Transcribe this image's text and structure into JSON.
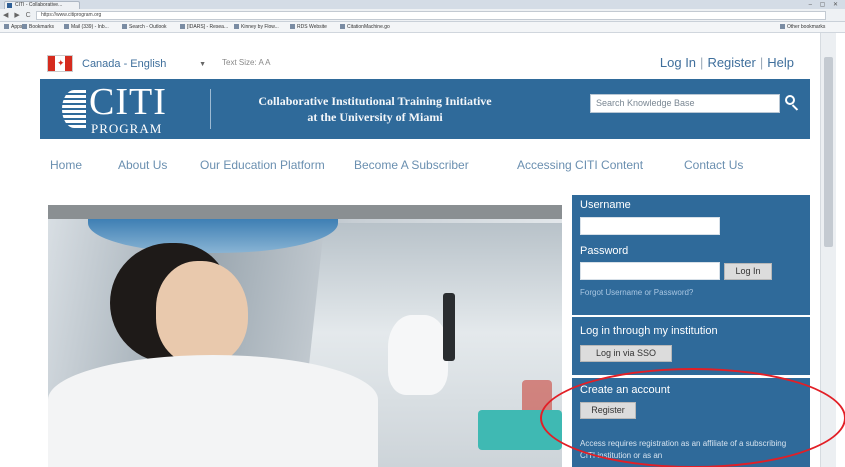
{
  "browser": {
    "tab_title": "CITI - Collaborative...",
    "window_controls": "–  ▢  ✕",
    "nav_buttons": "◀ ▶ C",
    "url": "https://www.citiprogram.org",
    "bookmarks": [
      "Apps",
      "Bookmarks",
      "Mail (339) - Inb...",
      "Search - Outlook",
      "[IDARS] - Resea...",
      "Kinney by Flow...",
      "RDS Website",
      "CitationMachine.go"
    ],
    "other_bookmarks": "Other bookmarks"
  },
  "topbar": {
    "language": "Canada - English",
    "text_size": "Text Size: A A",
    "login": "Log In",
    "separator": "|",
    "register": "Register",
    "help": "Help"
  },
  "banner": {
    "logo_main": "CITI",
    "logo_sub": "PROGRAM",
    "tagline_line1": "Collaborative Institutional Training Initiative",
    "tagline_line2": "at the University of Miami",
    "search_placeholder": "Search Knowledge Base"
  },
  "nav": {
    "items": [
      "Home",
      "About Us",
      "Our Education Platform",
      "Become A Subscriber",
      "Accessing CITI Content",
      "Contact Us"
    ]
  },
  "login_panel": {
    "username_label": "Username",
    "password_label": "Password",
    "login_button": "Log In",
    "forgot_link": "Forgot Username or Password?"
  },
  "institution_panel": {
    "heading": "Log in through my institution",
    "sso_button": "Log in via SSO"
  },
  "create_panel": {
    "heading": "Create an account",
    "register_button": "Register",
    "note": "Access requires registration as an affiliate of a subscribing CITI institution or as an"
  },
  "colors": {
    "brand_blue": "#2f6a9a",
    "link_blue": "#3f6f9c",
    "annotation_red": "#e21f26"
  }
}
